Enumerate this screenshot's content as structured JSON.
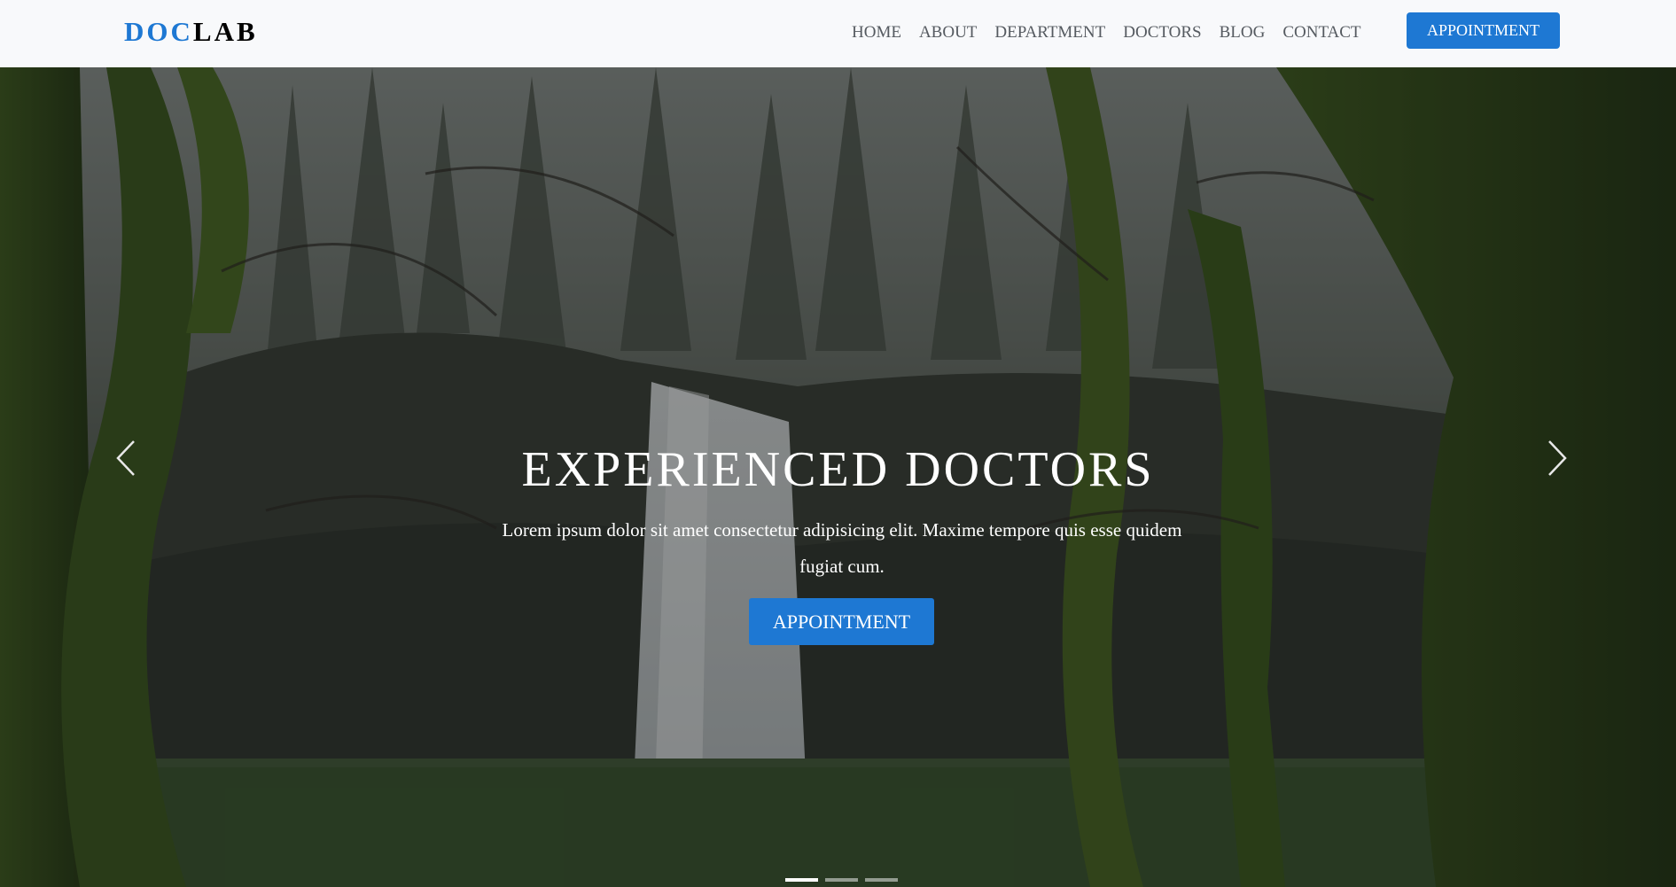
{
  "brand": {
    "part1": "DOC",
    "part2": "LAB"
  },
  "nav": {
    "links": [
      "HOME",
      "ABOUT",
      "DEPARTMENT",
      "DOCTORS",
      "BLOG",
      "CONTACT"
    ],
    "cta_label": "APPOINTMENT"
  },
  "hero": {
    "title": "EXPERIENCED DOCTORS",
    "text": "Lorem ipsum dolor sit amet consectetur adipisicing elit. Maxime tempore quis esse quidem fugiat cum.",
    "button_label": "APPOINTMENT",
    "slide_count": 3,
    "active_slide": 1
  },
  "colors": {
    "accent": "#1e78d3",
    "nav_bg": "#f8f9fb",
    "nav_text": "#555a60"
  },
  "icons": {
    "prev": "chevron-left-icon",
    "next": "chevron-right-icon"
  }
}
